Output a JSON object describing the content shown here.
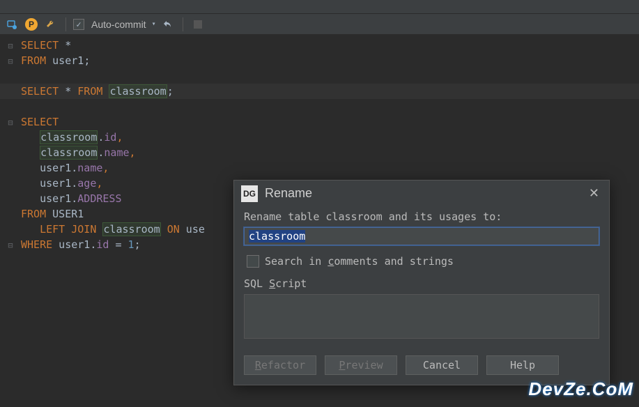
{
  "toolbar": {
    "auto_commit_label": "Auto-commit",
    "auto_commit_checked": true
  },
  "code": {
    "l1_kw1": "SELECT",
    "l1_star": " *",
    "l2_kw": "FROM",
    "l2_t": " user1",
    "l2_semi": ";",
    "l4_kw1": "SELECT",
    "l4_star": " * ",
    "l4_kw2": "FROM",
    "l4_sp": " ",
    "l4_t": "classroom",
    "l4_semi": ";",
    "l6_kw": "SELECT",
    "l7_pre": "   ",
    "l7_t": "classroom",
    "l7_dot": ".",
    "l7_f": "id",
    "l7_c": ",",
    "l8_pre": "   ",
    "l8_t": "classroom",
    "l8_dot": ".",
    "l8_f": "name",
    "l8_c": ",",
    "l9_pre": "   user1.",
    "l9_f": "name",
    "l9_c": ",",
    "l10_pre": "   user1.",
    "l10_f": "age",
    "l10_c": ",",
    "l11_pre": "   user1.",
    "l11_f": "ADDRESS",
    "l12_kw": "FROM",
    "l12_t": " USER1",
    "l13_pre": "   ",
    "l13_kw": "LEFT JOIN",
    "l13_sp": " ",
    "l13_t": "classroom",
    "l13_sp2": " ",
    "l13_kw2": "ON",
    "l13_rest": " use",
    "l14_kw": "WHERE",
    "l14_t": " user1.",
    "l14_f": "id",
    "l14_eq": " = ",
    "l14_n": "1",
    "l14_semi": ";"
  },
  "dialog": {
    "logo": "DG",
    "title": "Rename",
    "prompt": "Rename table classroom and its usages to:",
    "input_value": "classroom",
    "search_label_pre": "Search in ",
    "search_label_u": "c",
    "search_label_post": "omments and strings",
    "script_pre": "SQL ",
    "script_u": "S",
    "script_post": "cript",
    "btn_refactor_u": "R",
    "btn_refactor_post": "efactor",
    "btn_preview_u": "P",
    "btn_preview_post": "review",
    "btn_cancel": "Cancel",
    "btn_help": "Help"
  },
  "watermark": "DevZe.CoM"
}
